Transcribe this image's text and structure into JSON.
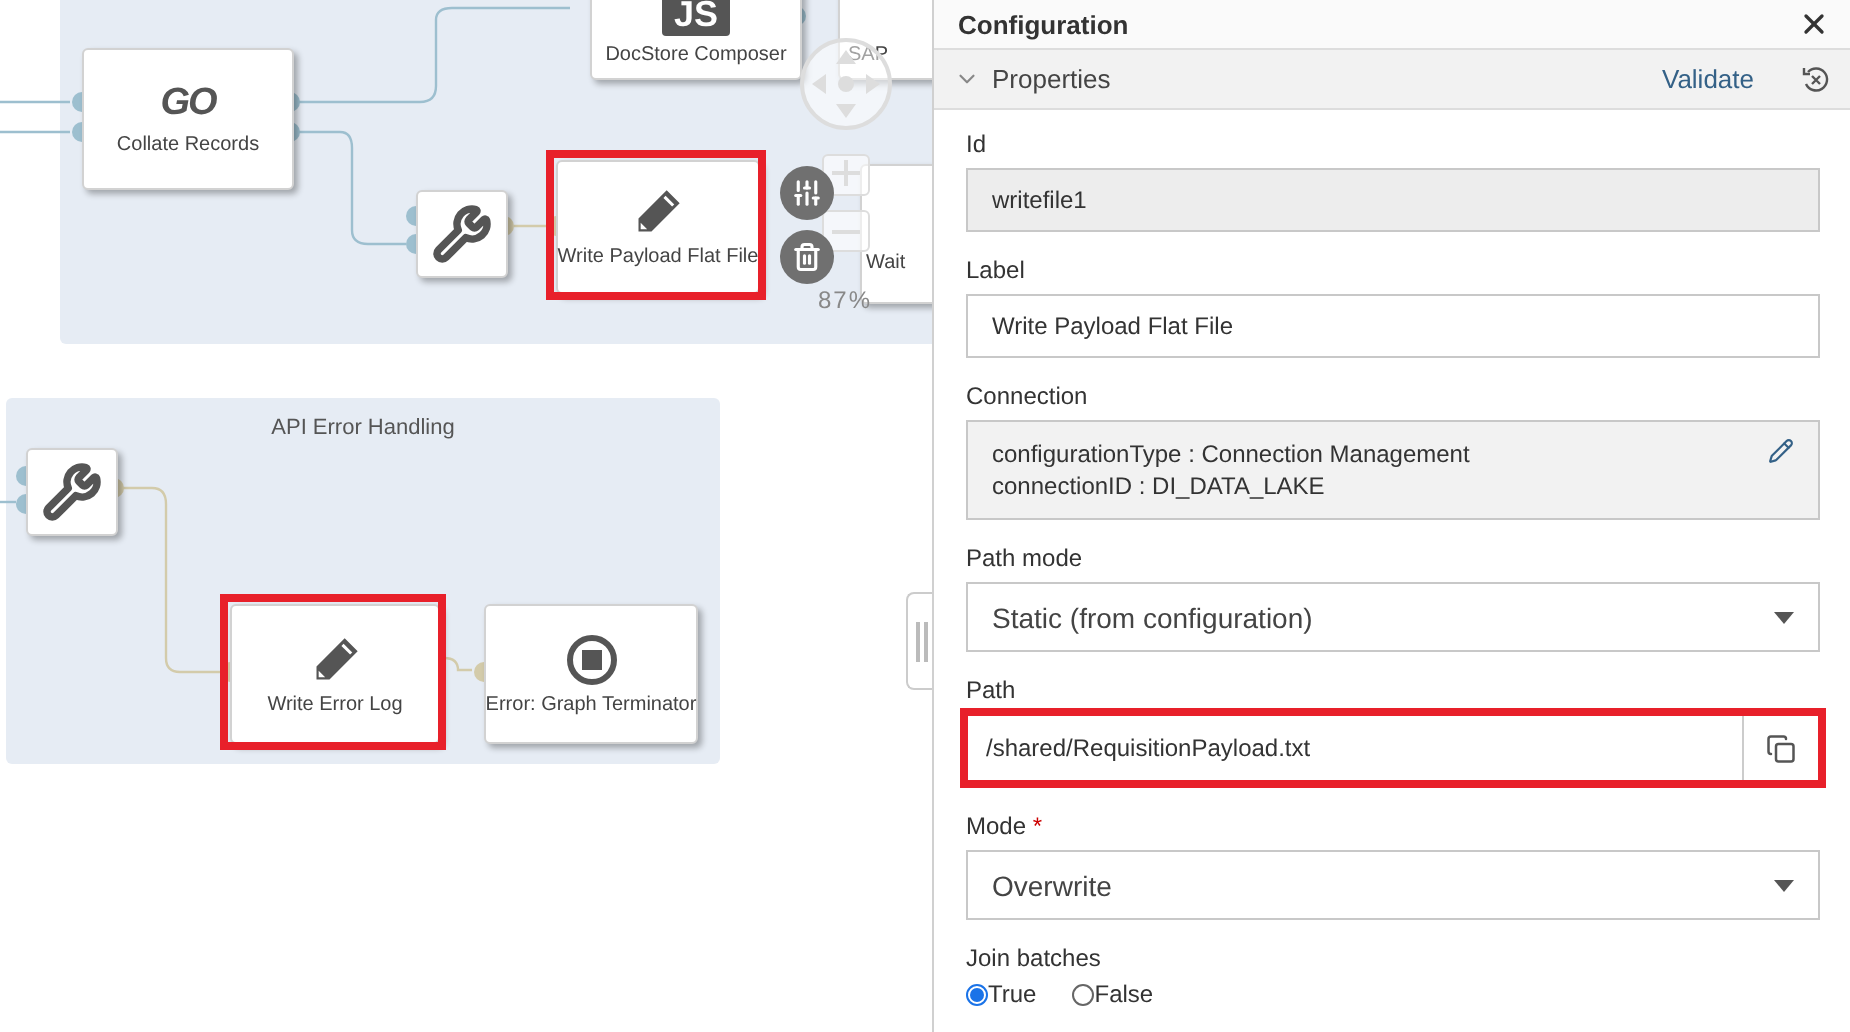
{
  "canvas": {
    "groups": [
      {
        "kind": "plain"
      },
      {
        "kind": "titled",
        "title": "API Error Handling"
      }
    ],
    "nodes": [
      {
        "kind": "go",
        "logo": "GO",
        "label": "Collate Records",
        "highlighted": false
      },
      {
        "kind": "js",
        "logo": "JS",
        "label": "DocStore Composer",
        "highlighted": false
      },
      {
        "kind": "sap",
        "label": "SAP",
        "highlighted": false
      },
      {
        "kind": "wrench",
        "highlighted": false
      },
      {
        "kind": "write",
        "label": "Write Payload Flat File",
        "highlighted": true
      },
      {
        "kind": "plain",
        "label": "Wait",
        "highlighted": false
      },
      {
        "kind": "wrench",
        "highlighted": false
      },
      {
        "kind": "write",
        "label": "Write Error Log",
        "highlighted": true
      },
      {
        "kind": "stop",
        "label": "Error: Graph Terminator",
        "highlighted": false
      }
    ],
    "zoom_level": "87%"
  },
  "panel": {
    "title": "Configuration",
    "section": {
      "label": "Properties",
      "expanded": true,
      "action": "Validate"
    },
    "fields": [
      {
        "kind": "readonly",
        "label": "Id",
        "value": "writefile1"
      },
      {
        "kind": "text",
        "label": "Label",
        "value": "Write Payload Flat File"
      },
      {
        "kind": "connection",
        "label": "Connection",
        "lines": [
          "configurationType : Connection Management",
          "connectionID : DI_DATA_LAKE"
        ]
      },
      {
        "kind": "select",
        "label": "Path mode",
        "value": "Static (from configuration)"
      },
      {
        "kind": "path",
        "label": "Path",
        "value": "/shared/RequisitionPayload.txt",
        "highlighted": true
      },
      {
        "kind": "select",
        "label": "Mode",
        "value": "Overwrite",
        "required_mark": "*"
      },
      {
        "kind": "radio",
        "label": "Join batches",
        "options": [
          {
            "label": "True",
            "selected": true
          },
          {
            "label": "False",
            "selected": false
          }
        ]
      }
    ]
  }
}
